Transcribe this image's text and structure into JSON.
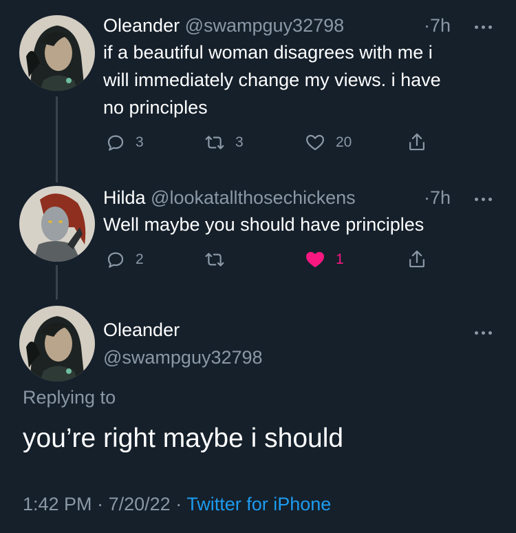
{
  "tweet1": {
    "name": "Oleander",
    "handle": "@swampguy32798",
    "time": "7h",
    "text_lines": [
      "if a beautiful woman disagrees with me i",
      "will immediately change my views. i have",
      "no principles"
    ],
    "reply_count": "3",
    "retweet_count": "3",
    "like_count": "20"
  },
  "tweet2": {
    "name": "Hilda",
    "handle": "@lookatallthosechickens",
    "time": "7h",
    "text": "Well maybe you should have principles",
    "reply_count": "2",
    "like_count": "1",
    "liked": true
  },
  "main_tweet": {
    "name": "Oleander",
    "handle": "@swampguy32798",
    "replying_to": "Replying to",
    "text": "you’re right maybe i should",
    "time": "1:42 PM",
    "date": "7/20/22",
    "source": "Twitter for iPhone"
  },
  "colors": {
    "background": "#15202b",
    "secondary_text": "#8b98a5",
    "link": "#1d9bf0",
    "like": "#f91880"
  },
  "icons": [
    "avatar",
    "reply-icon",
    "retweet-icon",
    "like-icon",
    "share-icon",
    "more-icon"
  ]
}
